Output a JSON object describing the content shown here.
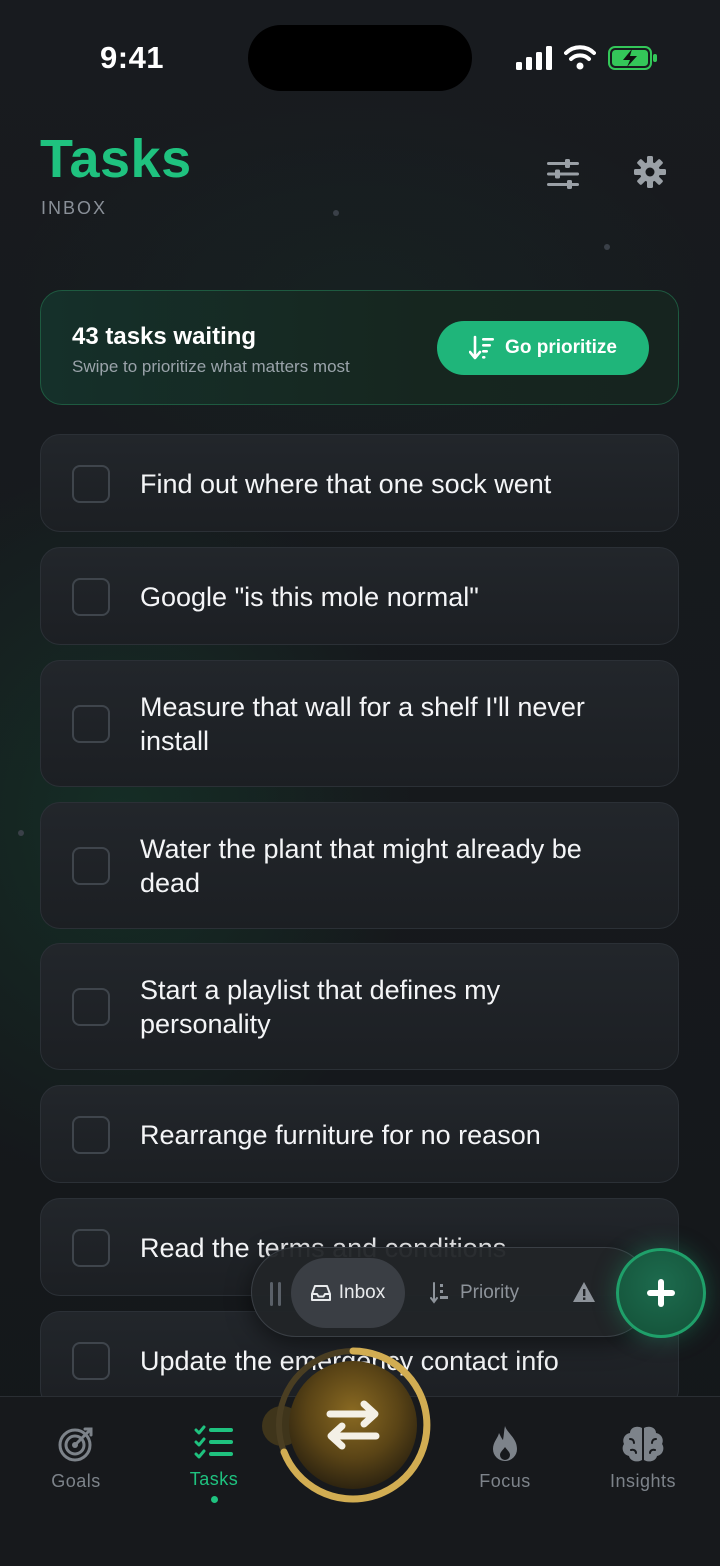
{
  "status_bar": {
    "time": "9:41"
  },
  "header": {
    "title": "Tasks",
    "subtitle": "INBOX"
  },
  "banner": {
    "title": "43 tasks waiting",
    "subtitle": "Swipe to prioritize what matters most",
    "button_label": "Go prioritize"
  },
  "tasks": [
    {
      "text": "Find out where that one sock went",
      "checked": false
    },
    {
      "text": "Google \"is this mole normal\"",
      "checked": false
    },
    {
      "text": "Measure that wall for a shelf I'll never install",
      "checked": false
    },
    {
      "text": "Water the plant that might already be dead",
      "checked": false
    },
    {
      "text": "Start a playlist that defines my personality",
      "checked": false
    },
    {
      "text": "Rearrange furniture for no reason",
      "checked": false
    },
    {
      "text": "Read the terms and conditions",
      "checked": false
    },
    {
      "text": "Update the emergency contact info",
      "checked": false
    }
  ],
  "filter_pill": {
    "segments": [
      {
        "label": "Inbox",
        "icon": "inbox-tray-icon",
        "selected": true
      },
      {
        "label": "Priority",
        "icon": "sort-priority-icon",
        "selected": false
      },
      {
        "label": "",
        "icon": "warning-icon",
        "selected": false
      }
    ]
  },
  "bottom_nav": {
    "items": [
      {
        "label": "Goals",
        "icon": "target-icon",
        "active": false
      },
      {
        "label": "Tasks",
        "icon": "checklist-icon",
        "active": true
      },
      {
        "label": "Focus",
        "icon": "flame-icon",
        "active": false
      },
      {
        "label": "Insights",
        "icon": "brain-icon",
        "active": false
      }
    ]
  },
  "colors": {
    "accent": "#1fc27f",
    "button_green": "#1fb57a",
    "background": "#15171a",
    "card": "#1f2226",
    "orb_gold": "#c9a34a"
  }
}
